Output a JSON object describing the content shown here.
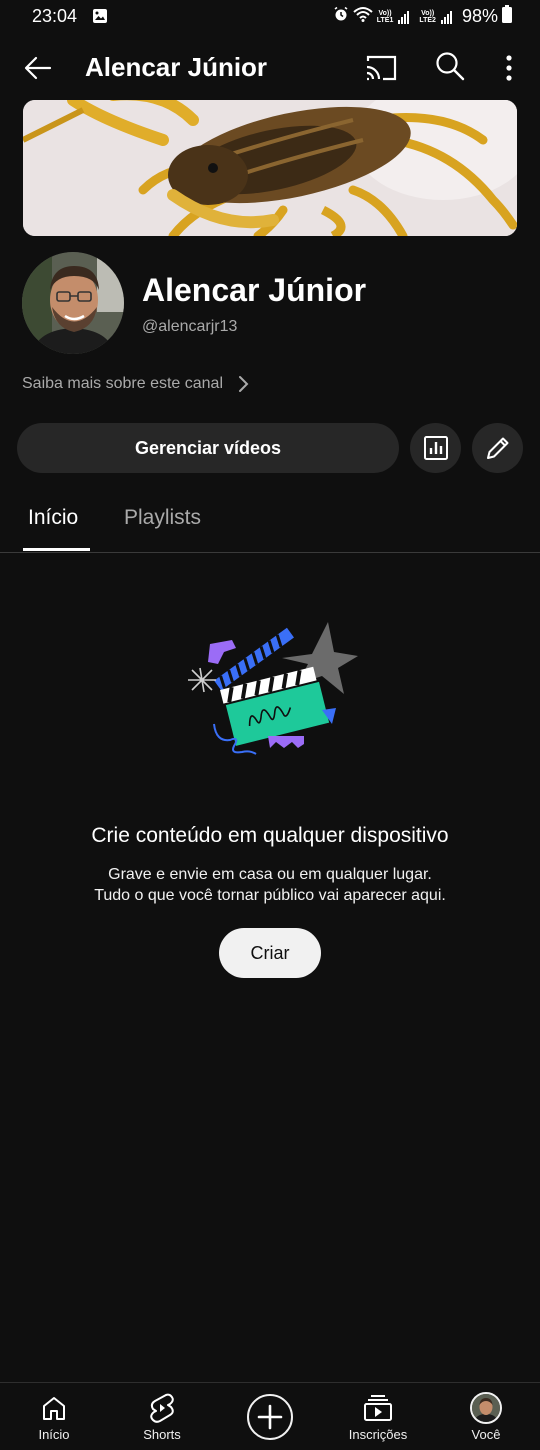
{
  "status_bar": {
    "time": "23:04",
    "battery": "98%",
    "sim1": "LTE1",
    "sim2": "LTE2",
    "volte": "Vo))"
  },
  "app_bar": {
    "title": "Alencar Júnior"
  },
  "channel": {
    "name": "Alencar Júnior",
    "handle": "@alencarjr13",
    "about_link": "Saiba mais sobre este canal"
  },
  "actions": {
    "manage_videos": "Gerenciar vídeos"
  },
  "tabs": [
    {
      "label": "Início",
      "active": true
    },
    {
      "label": "Playlists",
      "active": false
    }
  ],
  "empty_state": {
    "title": "Crie conteúdo em qualquer dispositivo",
    "description_line1": "Grave e envie em casa ou em qualquer lugar.",
    "description_line2": "Tudo o que você tornar público vai aparecer aqui.",
    "create_button": "Criar"
  },
  "bottom_nav": [
    {
      "label": "Início",
      "icon": "home-icon"
    },
    {
      "label": "Shorts",
      "icon": "shorts-icon"
    },
    {
      "label": "",
      "icon": "create-plus-icon"
    },
    {
      "label": "Inscrições",
      "icon": "subscriptions-icon"
    },
    {
      "label": "Você",
      "icon": "you-avatar"
    }
  ],
  "colors": {
    "background": "#0f0f0f",
    "surface": "#272727",
    "text_secondary": "#aaaaaa",
    "accent_green": "#1ec99a",
    "accent_blue": "#3a6ff7",
    "accent_purple": "#9b6cf6"
  }
}
